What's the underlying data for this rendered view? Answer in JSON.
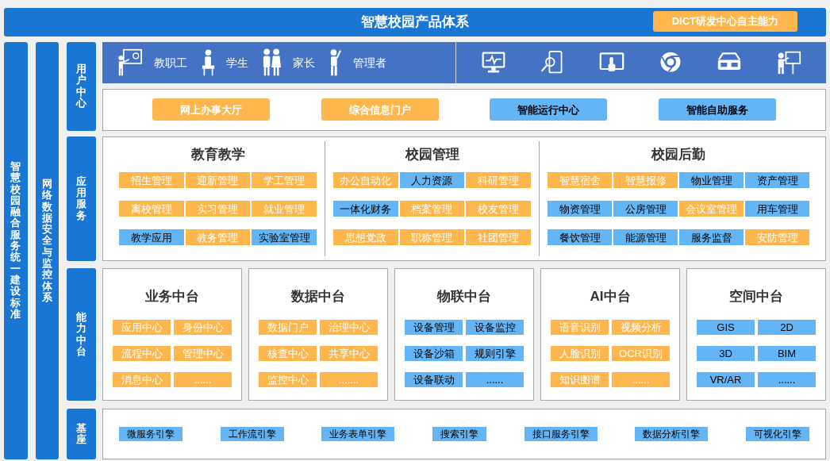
{
  "title": "智慧校园产品体系",
  "badge": "DICT研发中心自主能力",
  "side_labels": [
    "智慧校园融合服务统一建设标准",
    "网络数据安全与监控体系"
  ],
  "user_center": {
    "label": "用户中心",
    "roles": [
      {
        "name": "教职工",
        "kind": "teacher"
      },
      {
        "name": "学生",
        "kind": "student"
      },
      {
        "name": "家长",
        "kind": "parent"
      },
      {
        "name": "管理者",
        "kind": "manager"
      }
    ],
    "portals": [
      {
        "text": "网上办事大厅",
        "color": "#ffb74d"
      },
      {
        "text": "综合信息门户",
        "color": "#ffb74d"
      },
      {
        "text": "智能运行中心",
        "color": "#64b5f6"
      },
      {
        "text": "智能自助服务",
        "color": "#64b5f6"
      }
    ]
  },
  "app_services": {
    "label": "应用服务",
    "groups": [
      {
        "title": "教育教学",
        "items": [
          {
            "text": "招生管理",
            "color": "#ffb74d"
          },
          {
            "text": "迎新管理",
            "color": "#ffb74d"
          },
          {
            "text": "学工管理",
            "color": "#ffb74d"
          },
          {
            "text": "离校管理",
            "color": "#ffb74d"
          },
          {
            "text": "实习管理",
            "color": "#ffb74d"
          },
          {
            "text": "就业管理",
            "color": "#ffb74d"
          },
          {
            "text": "教学应用",
            "color": "#64b5f6"
          },
          {
            "text": "教务管理",
            "color": "#ffb74d"
          },
          {
            "text": "实验室管理",
            "color": "#64b5f6"
          }
        ]
      },
      {
        "title": "校园管理",
        "items": [
          {
            "text": "办公自动化",
            "color": "#ffb74d"
          },
          {
            "text": "人力资源",
            "color": "#64b5f6"
          },
          {
            "text": "科研管理",
            "color": "#ffb74d"
          },
          {
            "text": "一体化财务",
            "color": "#64b5f6"
          },
          {
            "text": "档案管理",
            "color": "#ffb74d"
          },
          {
            "text": "校友管理",
            "color": "#ffb74d"
          },
          {
            "text": "思想党政",
            "color": "#ffb74d"
          },
          {
            "text": "职称管理",
            "color": "#ffb74d"
          },
          {
            "text": "社团管理",
            "color": "#ffb74d"
          }
        ]
      },
      {
        "title": "校园后勤",
        "items": [
          {
            "text": "智慧宿舍",
            "color": "#ffb74d"
          },
          {
            "text": "智慧报修",
            "color": "#ffb74d"
          },
          {
            "text": "物业管理",
            "color": "#64b5f6"
          },
          {
            "text": "资产管理",
            "color": "#64b5f6"
          },
          {
            "text": "物资管理",
            "color": "#64b5f6"
          },
          {
            "text": "公房管理",
            "color": "#64b5f6"
          },
          {
            "text": "会议室管理",
            "color": "#ffb74d"
          },
          {
            "text": "用车管理",
            "color": "#64b5f6"
          },
          {
            "text": "餐饮管理",
            "color": "#64b5f6"
          },
          {
            "text": "能源管理",
            "color": "#64b5f6"
          },
          {
            "text": "服务监督",
            "color": "#64b5f6"
          },
          {
            "text": "安防管理",
            "color": "#ffb74d"
          }
        ]
      }
    ]
  },
  "capability": {
    "label": "能力中台",
    "platforms": [
      {
        "title": "业务中台",
        "items": [
          {
            "text": "应用中心",
            "color": "#ffb74d"
          },
          {
            "text": "身份中心",
            "color": "#ffb74d"
          },
          {
            "text": "流程中心",
            "color": "#ffb74d"
          },
          {
            "text": "管理中心",
            "color": "#ffb74d"
          },
          {
            "text": "消息中心",
            "color": "#ffb74d"
          },
          {
            "text": "......",
            "color": "#ffb74d"
          }
        ]
      },
      {
        "title": "数据中台",
        "items": [
          {
            "text": "数据门户",
            "color": "#ffb74d"
          },
          {
            "text": "治理中心",
            "color": "#ffb74d"
          },
          {
            "text": "核查中心",
            "color": "#ffb74d"
          },
          {
            "text": "共享中心",
            "color": "#ffb74d"
          },
          {
            "text": "监控中心",
            "color": "#ffb74d"
          },
          {
            "text": ".......",
            "color": "#ffb74d"
          }
        ]
      },
      {
        "title": "物联中台",
        "items": [
          {
            "text": "设备管理",
            "color": "#64b5f6"
          },
          {
            "text": "设备监控",
            "color": "#64b5f6"
          },
          {
            "text": "设备沙箱",
            "color": "#64b5f6"
          },
          {
            "text": "规则引擎",
            "color": "#64b5f6"
          },
          {
            "text": "设备联动",
            "color": "#64b5f6"
          },
          {
            "text": "......",
            "color": "#64b5f6"
          }
        ]
      },
      {
        "title": "AI中台",
        "items": [
          {
            "text": "语音识别",
            "color": "#ffb74d"
          },
          {
            "text": "视频分析",
            "color": "#ffb74d"
          },
          {
            "text": "人脸识别",
            "color": "#ffb74d"
          },
          {
            "text": "OCR识别",
            "color": "#ffb74d"
          },
          {
            "text": "知识图谱",
            "color": "#ffb74d"
          },
          {
            "text": "......",
            "color": "#ffb74d"
          }
        ]
      },
      {
        "title": "空间中台",
        "items": [
          {
            "text": "GIS",
            "color": "#64b5f6"
          },
          {
            "text": "2D",
            "color": "#64b5f6"
          },
          {
            "text": "3D",
            "color": "#64b5f6"
          },
          {
            "text": "BIM",
            "color": "#64b5f6"
          },
          {
            "text": "VR/AR",
            "color": "#64b5f6"
          },
          {
            "text": "......",
            "color": "#64b5f6"
          }
        ]
      }
    ]
  },
  "base": {
    "label": "基座",
    "engines": [
      "微服务引擎",
      "工作流引擎",
      "业务表单引擎",
      "搜索引擎",
      "接口服务引擎",
      "数据分析引擎",
      "可视化引擎"
    ]
  }
}
